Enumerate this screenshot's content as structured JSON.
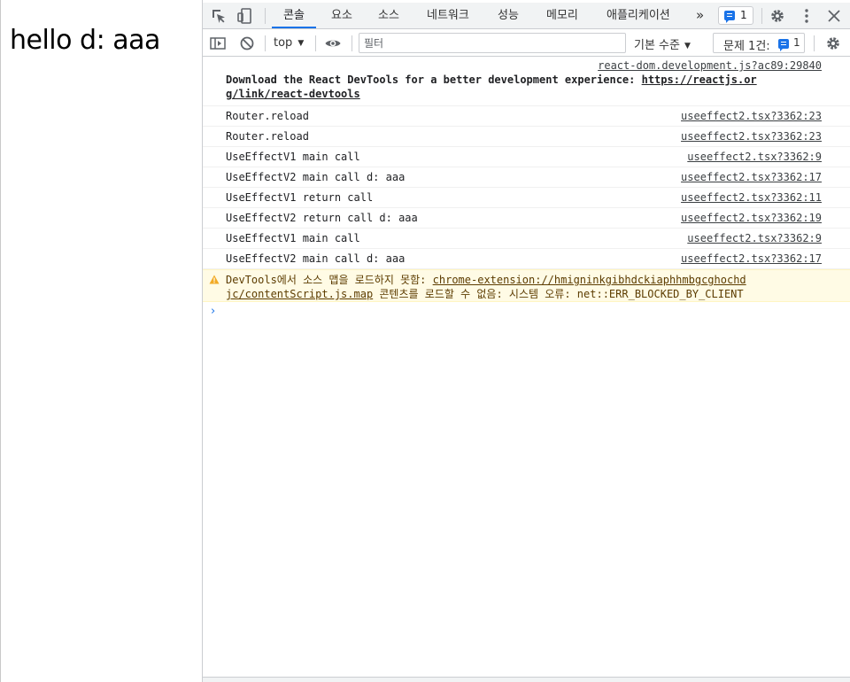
{
  "page": {
    "heading": "hello d: aaa"
  },
  "devtools": {
    "tabs": [
      {
        "label": "콘솔",
        "active": true
      },
      {
        "label": "요소",
        "active": false
      },
      {
        "label": "소스",
        "active": false
      },
      {
        "label": "네트워크",
        "active": false
      },
      {
        "label": "성능",
        "active": false
      },
      {
        "label": "메모리",
        "active": false
      },
      {
        "label": "애플리케이션",
        "active": false
      }
    ],
    "more_tabs": "»",
    "issue_badge_count": "1",
    "icons": [
      "inspect-icon",
      "device-toolbar-icon",
      "settings-icon",
      "more-vert-icon",
      "close-icon",
      "sidebar-toggle-icon",
      "clear-console-icon",
      "eye-icon",
      "console-settings-icon",
      "warning-icon"
    ],
    "colors": {
      "accent": "#1a73e8",
      "toolbar_bg": "#f1f3f4",
      "warning_bg": "#fffbe5",
      "warning_text": "#5c3c00",
      "warning_icon": "#f2ab26"
    }
  },
  "toolbar": {
    "context": "top",
    "filter_placeholder": "필터",
    "levels": "기본 수준",
    "issues_label": "문제 1건:",
    "issues_count": "1"
  },
  "console": {
    "intro": {
      "source": "react-dom.development.js?ac89:29840",
      "text": "Download the React DevTools for a better development experience: ",
      "link_line1": "https://reactjs.or",
      "link_line2": "g/link/react-devtools"
    },
    "messages": [
      {
        "text": "Router.reload",
        "source": "useeffect2.tsx?3362:23"
      },
      {
        "text": "Router.reload",
        "source": "useeffect2.tsx?3362:23"
      },
      {
        "text": "UseEffectV1 main call",
        "source": "useeffect2.tsx?3362:9"
      },
      {
        "text": "UseEffectV2 main call d: aaa",
        "source": "useeffect2.tsx?3362:17"
      },
      {
        "text": "UseEffectV1 return call",
        "source": "useeffect2.tsx?3362:11"
      },
      {
        "text": "UseEffectV2 return call d: aaa",
        "source": "useeffect2.tsx?3362:19"
      },
      {
        "text": "UseEffectV1 main call",
        "source": "useeffect2.tsx?3362:9"
      },
      {
        "text": "UseEffectV2 main call d: aaa",
        "source": "useeffect2.tsx?3362:17"
      }
    ],
    "warning": {
      "prefix": "DevTools에서 소스 맵을 로드하지 못함: ",
      "link1": "chrome-extension://hmigninkgibhdckiaphhmbgcghochd",
      "link2": "jc/contentScript.js.map",
      "suffix": " 콘텐츠를 로드할 수 없음: 시스템 오류: net::ERR_BLOCKED_BY_CLIENT"
    },
    "prompt": "›"
  }
}
